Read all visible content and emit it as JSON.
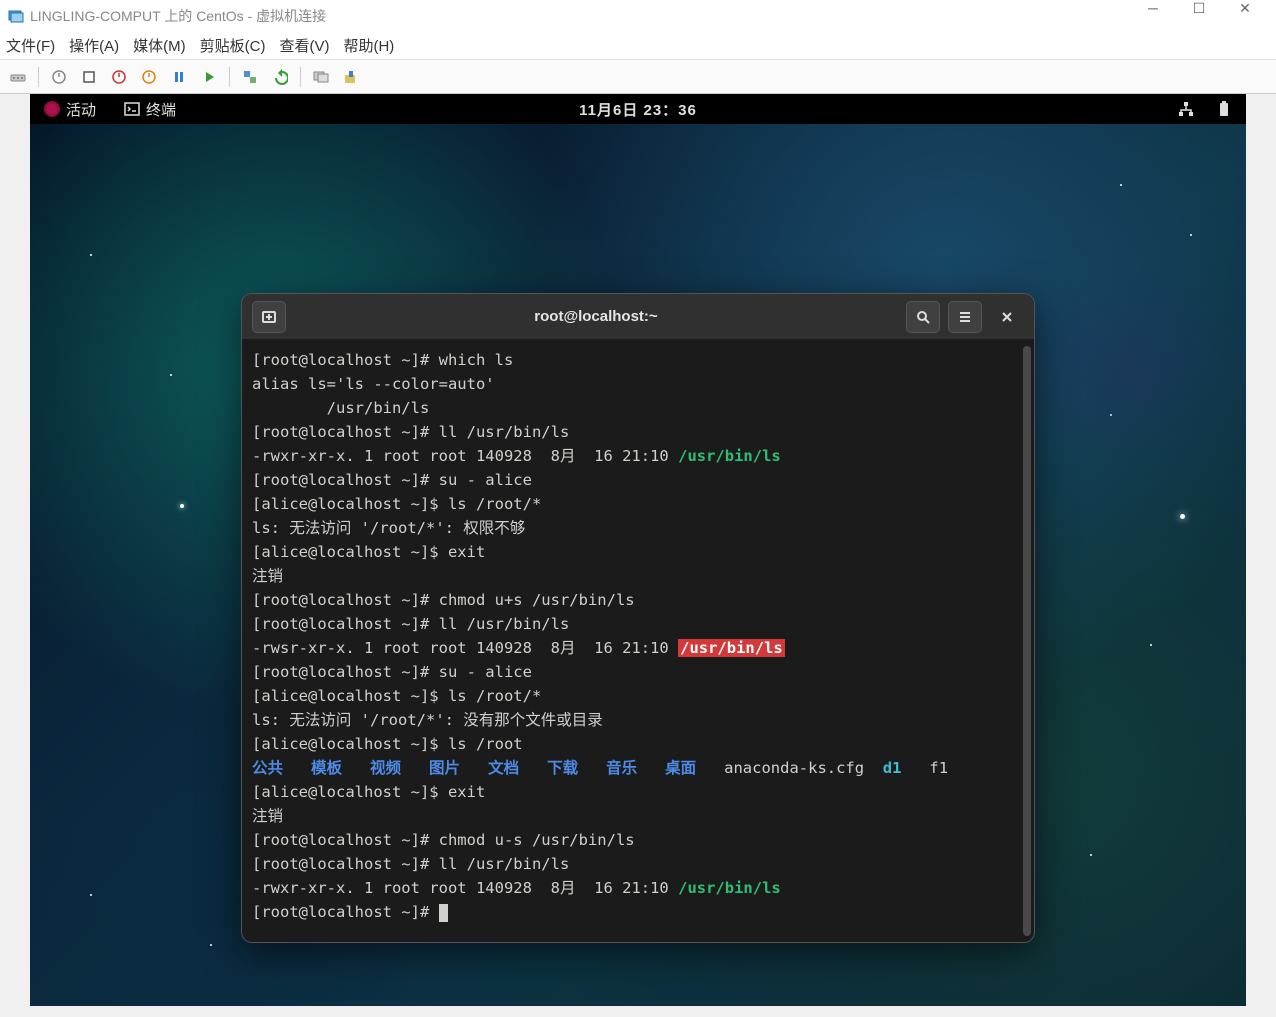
{
  "host": {
    "title": "LINGLING-COMPUT 上的 CentOs - 虚拟机连接",
    "menus": [
      "文件(F)",
      "操作(A)",
      "媒体(M)",
      "剪贴板(C)",
      "查看(V)",
      "帮助(H)"
    ]
  },
  "gnome": {
    "activities": "活动",
    "app": "终端",
    "clock": "11月6日 23：36"
  },
  "terminal": {
    "title": "root@localhost:~",
    "lines": [
      [
        {
          "t": "[root@localhost ~]# which ls"
        }
      ],
      [
        {
          "t": "alias ls='ls --color=auto'"
        }
      ],
      [
        {
          "t": "        /usr/bin/ls"
        }
      ],
      [
        {
          "t": "[root@localhost ~]# ll /usr/bin/ls"
        }
      ],
      [
        {
          "t": "-rwxr-xr-x. 1 root root 140928  8月  16 21:10 "
        },
        {
          "t": "/usr/bin/ls",
          "c": "green"
        }
      ],
      [
        {
          "t": "[root@localhost ~]# su - alice"
        }
      ],
      [
        {
          "t": "[alice@localhost ~]$ ls /root/*"
        }
      ],
      [
        {
          "t": "ls: 无法访问 '/root/*': 权限不够"
        }
      ],
      [
        {
          "t": "[alice@localhost ~]$ exit"
        }
      ],
      [
        {
          "t": "注销"
        }
      ],
      [
        {
          "t": "[root@localhost ~]# chmod u+s /usr/bin/ls"
        }
      ],
      [
        {
          "t": "[root@localhost ~]# ll /usr/bin/ls"
        }
      ],
      [
        {
          "t": "-rwsr-xr-x. 1 root root 140928  8月  16 21:10 "
        },
        {
          "t": "/usr/bin/ls",
          "c": "red-hl"
        }
      ],
      [
        {
          "t": "[root@localhost ~]# su - alice"
        }
      ],
      [
        {
          "t": "[alice@localhost ~]$ ls /root/*"
        }
      ],
      [
        {
          "t": "ls: 无法访问 '/root/*': 没有那个文件或目录"
        }
      ],
      [
        {
          "t": "[alice@localhost ~]$ ls /root"
        }
      ],
      [
        {
          "t": "公共",
          "c": "blue"
        },
        {
          "t": "   "
        },
        {
          "t": "模板",
          "c": "blue"
        },
        {
          "t": "   "
        },
        {
          "t": "视频",
          "c": "blue"
        },
        {
          "t": "   "
        },
        {
          "t": "图片",
          "c": "blue"
        },
        {
          "t": "   "
        },
        {
          "t": "文档",
          "c": "blue"
        },
        {
          "t": "   "
        },
        {
          "t": "下载",
          "c": "blue"
        },
        {
          "t": "   "
        },
        {
          "t": "音乐",
          "c": "blue"
        },
        {
          "t": "   "
        },
        {
          "t": "桌面",
          "c": "blue"
        },
        {
          "t": "   anaconda-ks.cfg  "
        },
        {
          "t": "d1",
          "c": "cyan"
        },
        {
          "t": "   f1"
        }
      ],
      [
        {
          "t": "[alice@localhost ~]$ exit"
        }
      ],
      [
        {
          "t": "注销"
        }
      ],
      [
        {
          "t": "[root@localhost ~]# chmod u-s /usr/bin/ls"
        }
      ],
      [
        {
          "t": "[root@localhost ~]# ll /usr/bin/ls"
        }
      ],
      [
        {
          "t": "-rwxr-xr-x. 1 root root 140928  8月  16 21:10 "
        },
        {
          "t": "/usr/bin/ls",
          "c": "green"
        }
      ],
      [
        {
          "t": "[root@localhost ~]# "
        },
        {
          "cursor": true
        }
      ]
    ]
  }
}
